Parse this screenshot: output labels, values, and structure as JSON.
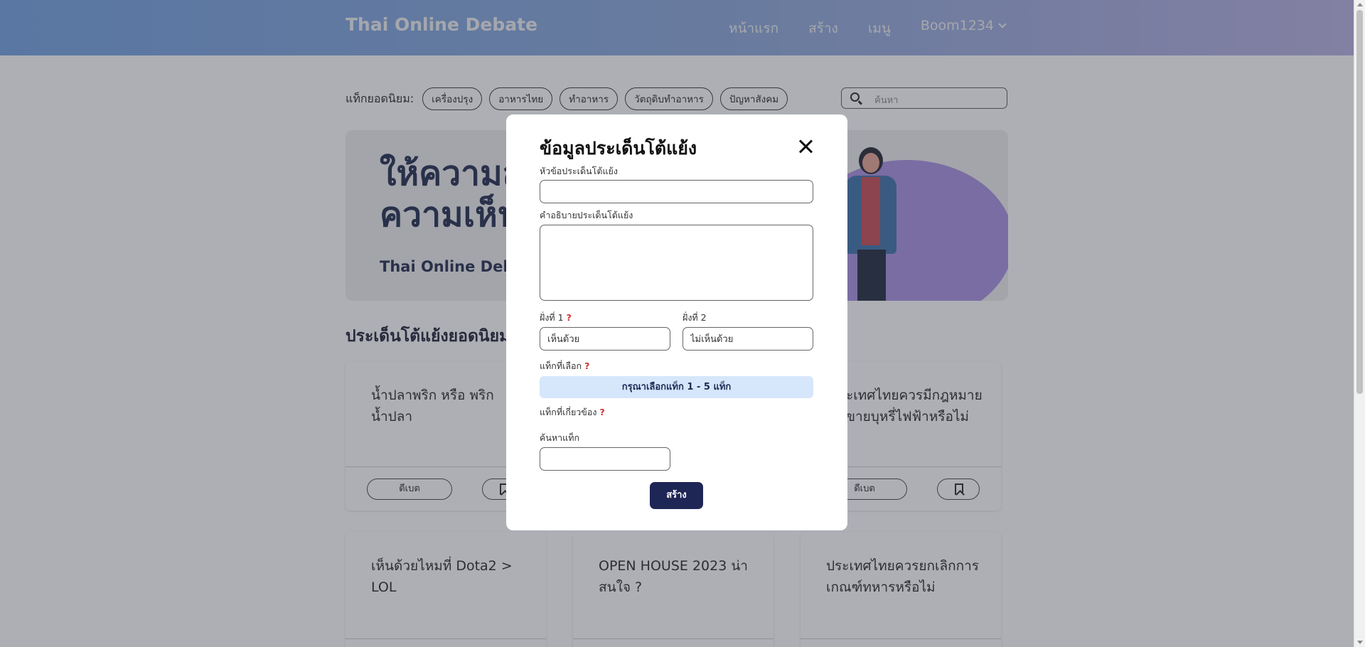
{
  "header": {
    "brand": "Thai Online Debate",
    "nav": [
      "หน้าแรก",
      "สร้าง",
      "เมนู"
    ],
    "user": "Boom1234"
  },
  "tags_bar": {
    "label": "แท็กยอดนิยม:",
    "tags": [
      "เครื่องปรุง",
      "อาหารไทย",
      "ทำอาหาร",
      "วัตถุดิบทำอาหาร",
      "ปัญหาสังคม"
    ]
  },
  "search": {
    "placeholder": "ค้นหา"
  },
  "banner": {
    "title_line1": "ให้ความสำ",
    "title_line2": "ความเห็น",
    "subtitle": "Thai Online Debat"
  },
  "section": {
    "title": "ประเด็นโต้แย้งยอดนิยม"
  },
  "cards": [
    {
      "title": "น้ำปลาพริก หรือ พริกน้ำปลา",
      "debate": "ดีเบต"
    },
    {
      "title": "ะเทศไทยควรมีกฎหมาย ขายบุหรี่ไฟฟ้าหรือไม่",
      "debate": "ดีเบต"
    },
    {
      "title": "เห็นด้วยไหมที่ Dota2 > LOL"
    },
    {
      "title": "OPEN HOUSE 2023 น่าสนใจ ?"
    },
    {
      "title": "ประเทศไทยควรยกเลิกการเกณฑ์ทหารหรือไม่"
    }
  ],
  "modal": {
    "title": "ข้อมูลประเด็นโต้แย้ง",
    "topic_label": "หัวข้อประเด็นโต้แย้ง",
    "desc_label": "คำอธิบายประเด็นโต้แย้ง",
    "side1_label": "ฝั่งที่ 1",
    "side2_label": "ฝั่งที่ 2",
    "side1_value": "เห็นด้วย",
    "side2_value": "ไม่เห็นด้วย",
    "selected_tags_label": "แท็กที่เลือก",
    "tag_hint": "กรุณาเลือกแท็ก 1 - 5 แท็ก",
    "related_tags_label": "แท็กที่เกี่ยวข้อง",
    "search_tag_label": "ค้นหาแท็ก",
    "help_mark": "?",
    "create_button": "สร้าง"
  }
}
